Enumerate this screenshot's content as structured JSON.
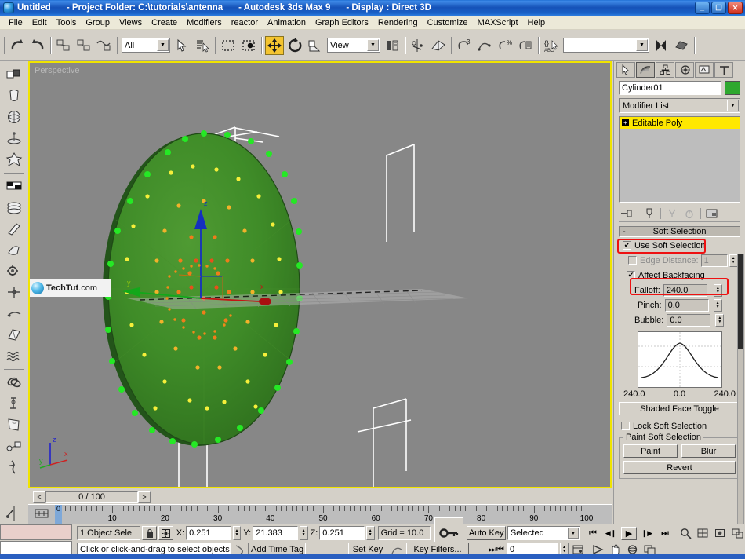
{
  "titlebar": {
    "app_icon": "max-logo-icon",
    "doc": "Untitled",
    "project": "- Project Folder: C:\\tutorials\\antenna",
    "product": "- Autodesk 3ds Max 9",
    "display": "- Display : Direct 3D",
    "minimize": "_",
    "restore": "❐",
    "close": "✕"
  },
  "menubar": {
    "items": [
      "File",
      "Edit",
      "Tools",
      "Group",
      "Views",
      "Create",
      "Modifiers",
      "reactor",
      "Animation",
      "Graph Editors",
      "Rendering",
      "Customize",
      "MAXScript",
      "Help"
    ]
  },
  "toolbar": {
    "undo": "undo-icon",
    "redo": "redo-icon",
    "select_link": "select-and-link-icon",
    "unlink": "unlink-selection-icon",
    "bind_space_warp": "bind-to-space-warp-icon",
    "selection_filter_value": "All",
    "select_object": "select-object-icon",
    "select_by_name": "select-by-name-icon",
    "select_region": "rectangular-selection-region-icon",
    "window_crossing": "window-crossing-icon",
    "select_move": "select-and-move-icon",
    "select_rotate": "select-and-rotate-icon",
    "select_scale": "select-and-scale-icon",
    "ref_coord_value": "View",
    "use_pivot": "use-pivot-point-center-icon",
    "mirror": "mirror-icon",
    "align": "align-icon",
    "layers": "layer-manager-icon",
    "curve_editor": "curve-editor-icon",
    "schematic": "schematic-view-icon",
    "material_editor": "material-editor-icon",
    "named_selection_value": "",
    "render_scene": "render-scene-icon",
    "quick_render": "quick-render-icon"
  },
  "left_toolbar": {
    "items": [
      {
        "name": "standard-primitives-icon"
      },
      {
        "name": "extended-primitives-icon"
      },
      {
        "name": "compound-objects-icon"
      },
      {
        "name": "particle-systems-icon"
      },
      {
        "name": "patch-grids-icon"
      },
      {
        "name": "nurbs-surfaces-icon"
      },
      {
        "name": "doors-icon"
      },
      {
        "name": "windows-icon"
      },
      {
        "name": "stairs-icon"
      },
      {
        "name": "gear-helpers-icon"
      },
      {
        "name": "cameras-icon"
      },
      {
        "name": "lights-icon"
      },
      {
        "name": "space-warps-icon"
      },
      {
        "name": "dynamics-icon"
      },
      {
        "name": "torus-knot-icon"
      },
      {
        "name": "bones-icon"
      },
      {
        "name": "surface-tools-icon"
      },
      {
        "name": "link-objects-icon"
      },
      {
        "name": "systems-icon"
      }
    ]
  },
  "viewport": {
    "label": "Perspective",
    "watermark_brand": "TechTut",
    "watermark_suffix": ".com",
    "axis_x": "x",
    "axis_y": "y",
    "axis_z": "z"
  },
  "timeline": {
    "prev_label": "<",
    "next_label": ">",
    "frame_display": "0 / 100",
    "tick_labels": [
      "10",
      "20",
      "30",
      "40",
      "50",
      "60",
      "70",
      "80",
      "90",
      "100"
    ],
    "handle_label": "0"
  },
  "status": {
    "selection_count": "1 Object Sele",
    "lock_icon": "lock-selection-icon",
    "transform_icon": "absolute-relative-toggle-icon",
    "x_label": "X:",
    "x_value": "0.251",
    "y_label": "Y:",
    "y_value": "21.383",
    "z_label": "Z:",
    "z_value": "0.251",
    "grid_label": "Grid = 10.0",
    "prompt": "Click or click-and-drag to select objects",
    "add_time_tag": "Add Time Tag",
    "snaps_icon": "snaps-toggle-icon",
    "key_mode_icon": "key-mode-toggle-icon"
  },
  "animation": {
    "auto_key": "Auto Key",
    "set_key": "Set Key",
    "key_filters": "Key Filters...",
    "selected_dropdown": "Selected",
    "curve_icon": "default-in-out-tangent-icon",
    "goto_start": "⏮",
    "prev_frame": "◀❙",
    "play": "▶",
    "next_frame": "❙▶",
    "goto_end": "⏭",
    "key_mode": "⏭⏮",
    "current_frame": "0",
    "time_config_icon": "time-configuration-icon"
  },
  "nav_controls": {
    "zoom": "zoom-icon",
    "zoom_all": "zoom-all-icon",
    "zoom_extents": "zoom-extents-icon",
    "zoom_region": "zoom-region-icon",
    "fov": "field-of-view-icon",
    "pan": "pan-view-icon",
    "orbit": "arc-rotate-icon",
    "maximize": "maximize-viewport-toggle-icon"
  },
  "command_panel": {
    "tabs": [
      {
        "name": "create-tab",
        "icon": "arrow-cursor-icon",
        "selected": false
      },
      {
        "name": "modify-tab",
        "icon": "rainbow-arc-icon",
        "selected": true
      },
      {
        "name": "hierarchy-tab",
        "icon": "hierarchy-tree-icon",
        "selected": false
      },
      {
        "name": "motion-tab",
        "icon": "wheel-icon",
        "selected": false
      },
      {
        "name": "display-tab",
        "icon": "monitor-icon",
        "selected": false
      },
      {
        "name": "utilities-tab",
        "icon": "hammer-icon",
        "selected": false
      }
    ],
    "object_name": "Cylinder01",
    "object_color": "#2fa82f",
    "modifier_list_label": "Modifier List",
    "stack": [
      {
        "label": "Editable Poly",
        "selected": true
      }
    ],
    "stack_tools": [
      "pin-stack-icon",
      "show-end-result-icon",
      "make-unique-icon",
      "remove-modifier-icon",
      "configure-modifier-sets-icon"
    ]
  },
  "soft_selection": {
    "header": "Soft Selection",
    "collapse_glyph": "-",
    "use_soft_selection": {
      "label": "Use Soft Selection",
      "checked": true,
      "mark": "✔"
    },
    "edge_distance": {
      "label": "Edge Distance:",
      "checked": false,
      "value": "1"
    },
    "affect_backfacing": {
      "label": "Affect Backfacing",
      "checked": true,
      "mark": "✔"
    },
    "falloff": {
      "label": "Falloff:",
      "value": "240.0"
    },
    "pinch": {
      "label": "Pinch:",
      "value": "0.0"
    },
    "bubble": {
      "label": "Bubble:",
      "value": "0.0"
    },
    "curve_left_label": "240.0",
    "curve_center_label": "0.0",
    "curve_right_label": "240.0",
    "shaded_face_toggle": "Shaded Face Toggle",
    "lock_soft_selection": {
      "label": "Lock Soft Selection",
      "checked": false
    },
    "paint_group_label": "Paint Soft Selection",
    "paint": "Paint",
    "blur": "Blur",
    "revert": "Revert",
    "highlight_color": "#ee1111"
  }
}
